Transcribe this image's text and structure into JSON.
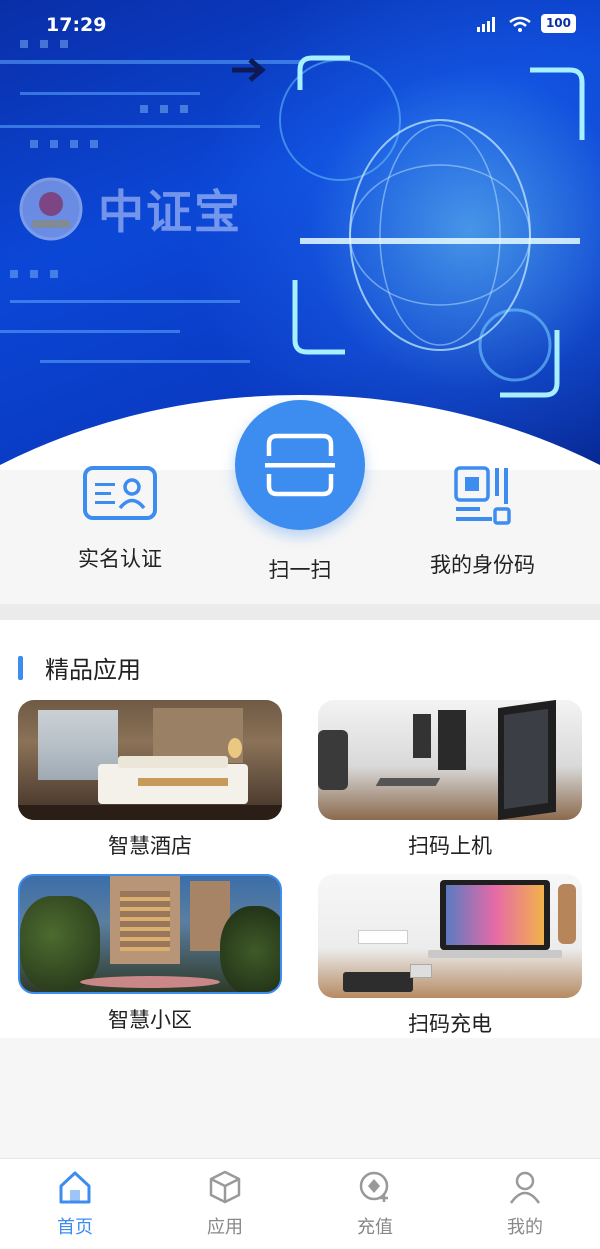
{
  "status_bar": {
    "time": "17:29",
    "battery": "100"
  },
  "hero": {
    "brand_name": "中证宝"
  },
  "quick_actions": [
    {
      "label": "实名认证",
      "icon": "id-card-icon"
    },
    {
      "label": "扫一扫",
      "icon": "scan-icon"
    },
    {
      "label": "我的身份码",
      "icon": "qr-code-icon"
    }
  ],
  "premium_apps": {
    "title": "精品应用",
    "items": [
      {
        "label": "智慧酒店",
        "image": "hotel-room-photo"
      },
      {
        "label": "扫码上机",
        "image": "computer-lab-photo"
      },
      {
        "label": "智慧小区",
        "image": "residential-community-photo"
      },
      {
        "label": "扫码充电",
        "image": "laptop-charging-photo"
      }
    ]
  },
  "tabbar": {
    "active": "首页",
    "items": [
      {
        "label": "首页",
        "icon": "home-icon"
      },
      {
        "label": "应用",
        "icon": "cube-icon"
      },
      {
        "label": "充值",
        "icon": "recharge-icon"
      },
      {
        "label": "我的",
        "icon": "user-icon"
      }
    ]
  },
  "colors": {
    "accent": "#3d8cf0",
    "hero_blue": "#0b47d6"
  }
}
